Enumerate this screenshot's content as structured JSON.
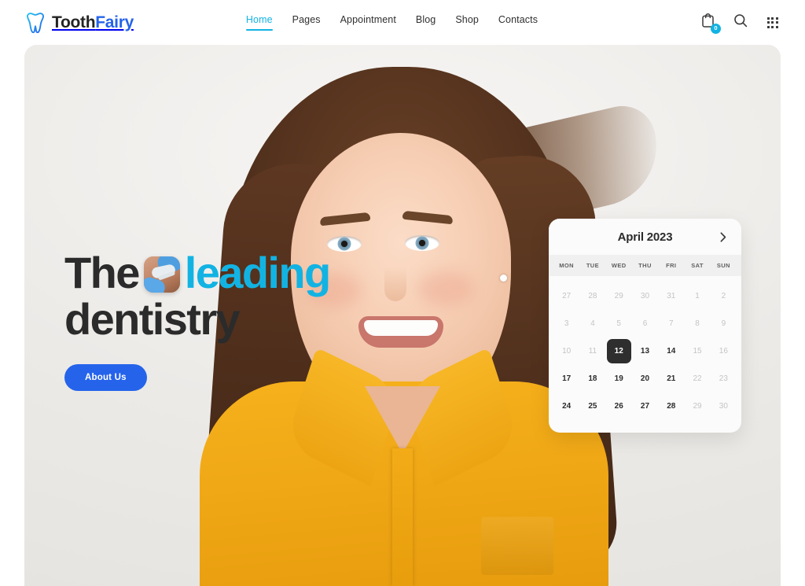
{
  "header": {
    "brand": {
      "name_part1": "Tooth",
      "name_part2": "Fairy",
      "icon": "tooth-icon"
    },
    "nav": [
      {
        "label": "Home",
        "active": true
      },
      {
        "label": "Pages",
        "active": false
      },
      {
        "label": "Appointment",
        "active": false
      },
      {
        "label": "Blog",
        "active": false
      },
      {
        "label": "Shop",
        "active": false
      },
      {
        "label": "Contacts",
        "active": false
      }
    ],
    "actions": {
      "cart": {
        "icon": "cart-icon",
        "badge_count": "0"
      },
      "search": {
        "icon": "search-icon"
      },
      "apps": {
        "icon": "grid-menu-icon"
      }
    }
  },
  "hero": {
    "headline": {
      "part1": "The",
      "inline_image": "dental-procedure-thumbnail",
      "accent": "leading",
      "part2": "dentistry"
    },
    "cta_label": "About Us",
    "background_image": "smiling-woman-portrait"
  },
  "calendar": {
    "title": "April 2023",
    "next_icon": "chevron-right-icon",
    "weekdays": [
      "MON",
      "TUE",
      "WED",
      "THU",
      "FRI",
      "SAT",
      "SUN"
    ],
    "days": [
      {
        "label": "27",
        "state": "muted"
      },
      {
        "label": "28",
        "state": "muted"
      },
      {
        "label": "29",
        "state": "muted"
      },
      {
        "label": "30",
        "state": "muted"
      },
      {
        "label": "31",
        "state": "muted"
      },
      {
        "label": "1",
        "state": "muted"
      },
      {
        "label": "2",
        "state": "muted"
      },
      {
        "label": "3",
        "state": "muted"
      },
      {
        "label": "4",
        "state": "muted"
      },
      {
        "label": "5",
        "state": "muted"
      },
      {
        "label": "6",
        "state": "muted"
      },
      {
        "label": "7",
        "state": "muted"
      },
      {
        "label": "8",
        "state": "muted"
      },
      {
        "label": "9",
        "state": "muted"
      },
      {
        "label": "10",
        "state": "muted"
      },
      {
        "label": "11",
        "state": "muted"
      },
      {
        "label": "12",
        "state": "selected"
      },
      {
        "label": "13",
        "state": "normal"
      },
      {
        "label": "14",
        "state": "normal"
      },
      {
        "label": "15",
        "state": "muted"
      },
      {
        "label": "16",
        "state": "muted"
      },
      {
        "label": "17",
        "state": "normal"
      },
      {
        "label": "18",
        "state": "normal"
      },
      {
        "label": "19",
        "state": "normal"
      },
      {
        "label": "20",
        "state": "normal"
      },
      {
        "label": "21",
        "state": "normal"
      },
      {
        "label": "22",
        "state": "muted"
      },
      {
        "label": "23",
        "state": "muted"
      },
      {
        "label": "24",
        "state": "normal"
      },
      {
        "label": "25",
        "state": "normal"
      },
      {
        "label": "26",
        "state": "normal"
      },
      {
        "label": "27",
        "state": "normal"
      },
      {
        "label": "28",
        "state": "normal"
      },
      {
        "label": "29",
        "state": "muted"
      },
      {
        "label": "30",
        "state": "muted"
      }
    ]
  },
  "colors": {
    "accent_cyan": "#12b3e3",
    "brand_blue": "#2563eb",
    "text_dark": "#2b2b2b",
    "selected_day_bg": "#2e2e2e",
    "hero_bg": "#eeedeb",
    "shirt_yellow": "#f0a816"
  }
}
